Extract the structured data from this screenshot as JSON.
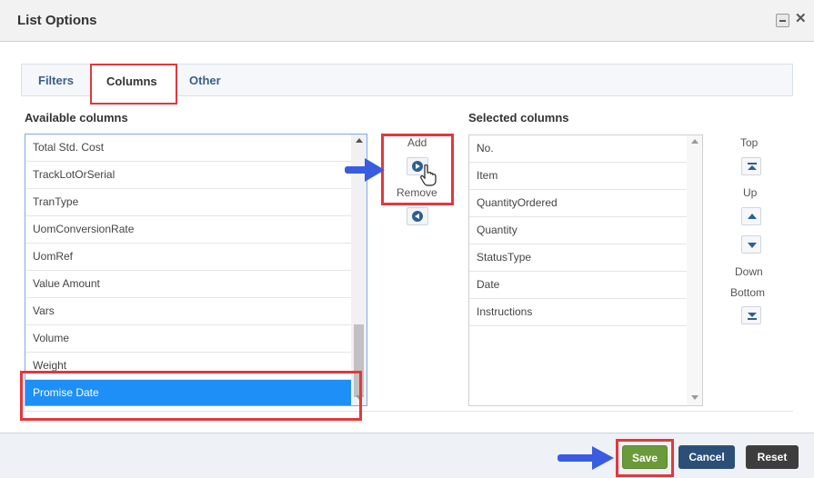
{
  "dialog": {
    "title": "List Options"
  },
  "tabs": {
    "filters": "Filters",
    "columns": "Columns",
    "other": "Other"
  },
  "available": {
    "label": "Available columns",
    "items": [
      "Total Std. Cost",
      "TrackLotOrSerial",
      "TranType",
      "UomConversionRate",
      "UomRef",
      "Value Amount",
      "Vars",
      "Volume",
      "Weight",
      "Promise Date"
    ],
    "selected_item": "Promise Date"
  },
  "selected": {
    "label": "Selected columns",
    "items": [
      "No.",
      "Item",
      "QuantityOrdered",
      "Quantity",
      "StatusType",
      "Date",
      "Instructions"
    ]
  },
  "transfer": {
    "add_label": "Add",
    "remove_label": "Remove"
  },
  "order": {
    "top_label": "Top",
    "up_label": "Up",
    "down_label": "Down",
    "bottom_label": "Bottom"
  },
  "footer": {
    "save_label": "Save",
    "cancel_label": "Cancel",
    "reset_label": "Reset"
  },
  "colors": {
    "selection": "#1e8ff7",
    "save": "#6a9a3a",
    "cancel": "#2c4f78",
    "reset": "#3d3d3d",
    "highlight": "#e4373c",
    "pointer_arrow": "#3a5ce0"
  }
}
